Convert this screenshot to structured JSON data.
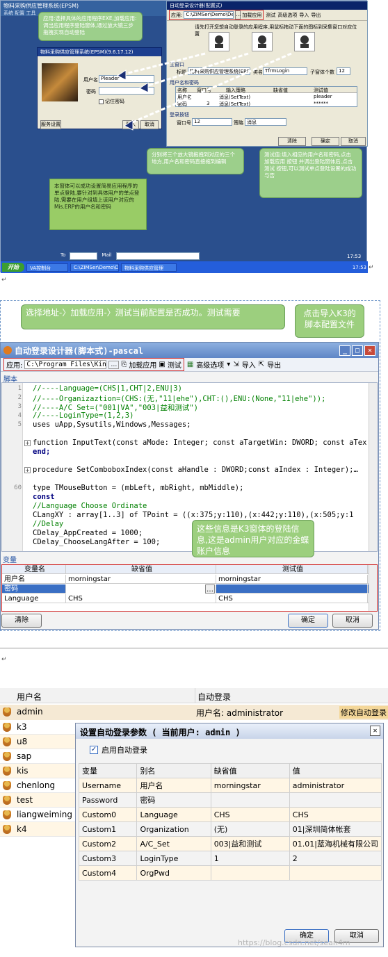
{
  "panel1": {
    "sys_title": "物料采购供应管理系统(EPSM)",
    "sys_menu": "系统  配置  工具",
    "main_title": "自动登录设计器(配置式)",
    "app_label": "应用:",
    "app_path": "C:\\ZIMSer\\Demo\\Dev\\Demo1\\",
    "load_btn": "加载应用",
    "test_btn": "测试",
    "adv_btn": "高级选项",
    "import_btn": "导入",
    "export_btn": "导出",
    "hint": "请先打开您想自动登录的应用程序,用鼠标拖动下面的图标到采集窗口对应位置",
    "main_section": "主窗口",
    "title_label": "标题",
    "title_value": "物料采购供应管理系统(EPSM)(9",
    "class_label": "类名",
    "class_value": "TfrmLogin",
    "sub_count_label": "子窗体个数",
    "sub_count": "12",
    "user_section": "用户名和密码",
    "col_headers": [
      "名称",
      "窗口号",
      "输入策略",
      "缺省值",
      "测试值"
    ],
    "rows": [
      [
        "用户名",
        "",
        "消息(SetText)",
        "",
        "pleader"
      ],
      [
        "密码",
        "3",
        "消息(SetText)",
        "",
        "******"
      ]
    ],
    "login_section": "登录按钮",
    "win_label": "窗口号",
    "win_value": "12",
    "strategy_label": "策略",
    "strategy_value": "消息",
    "clear_btn": "清除",
    "ok_btn": "确定",
    "cancel_btn": "取消",
    "bubble_top": "应用:选择具体的应用程序EXE,加载应用:调出应用程序登陆窗体,通过放大镜三步拖拽实现自动登陆",
    "login_title": "物料采购供应管理系统(EPSM)(9.6.17.12)",
    "login_user_label": "用户名",
    "login_user_value": "Pleader",
    "login_pwd_label": "密码",
    "remember": "记住密码",
    "server_btn": "服务设置",
    "login_ok": "登入",
    "login_cancel": "取消",
    "bubble_mid": "分别将三个放大镜拖拽到对应的三个地方,用户名和密码直接拖到编辑",
    "bubble_right": "测试值:填入相应的用户名和密码,点击 加载应用 按钮 并调出登陆窗体后,点击 测试 按钮,可以测试单点登陆设置的成功与否",
    "bubble_bottom": "本窗体可以成功设置简易应用程序的单点登陆,要针对到具体用户的单点登陆,需要在用户组填上该用户对应的Mis.ERP的用户名和密码",
    "status_to": "To",
    "status_mail": "Mail",
    "status_time": "17:53",
    "task_start": "开始",
    "task_items": [
      "VA控制台",
      "C:\\ZIMSer\\Demo\\Dev...",
      "物料采购供应管理"
    ],
    "task_time": "17:53"
  },
  "panel2": {
    "bubble_left": "选择地址-〉加载应用-〉测试当前配置是否成功。测试需要",
    "bubble_right": "点击导入K3的脚本配置文件",
    "title": "自动登录设计器(脚本式)-pascal",
    "app_label": "应用:",
    "app_path": "C:\\Program Files\\Kingdee",
    "load_btn": "加载应用",
    "test_btn": "测试",
    "adv_btn": "高级选项",
    "import_btn": "导入",
    "export_btn": "导出",
    "script_label": "脚本",
    "line_numbers": [
      "1",
      "2",
      "3",
      "4",
      "5",
      "",
      "",
      "",
      "",
      "",
      "60"
    ],
    "code": [
      "//----Language=(CHS|1,CHT|2,ENU|3)",
      "//----Organizaztion=(CHS:(无,\"11|ehe\"),CHT:(),ENU:(None,\"11|ehe\"));",
      "//----A/C Set=(\"001|VA\",\"003|益和测试\")",
      "//----LoginType=(1,2,3)",
      "uses uApp,Sysutils,Windows,Messages;",
      "function InputText(const aMode: Integer; const aTargetWin: DWORD; const aTex",
      "end;",
      "procedure SetComboboxIndex(const aHandle : DWORD;const aIndex : Integer);…",
      "type TMouseButton = (mbLeft, mbRight, mbMiddle);",
      "const",
      "  //Language Choose Ordinate",
      "  CLangXY : array[1..3] of TPoint = ((x:375;y:110),(x:442;y:110),(x:505;y:1",
      "  //Delay",
      "  CDelay_AppCreated = 1000;",
      "  CDelay_ChooseLangAfter = 100;"
    ],
    "bubble_info": "这些信息是K3窗体的登陆信息,这是admin用户对应的金蝶账户信息",
    "var_label": "变量",
    "grid_headers": [
      "变量名",
      "缺省值",
      "测试值"
    ],
    "grid_rows": [
      [
        "用户名",
        "morningstar",
        "morningstar"
      ],
      [
        "密码",
        "",
        ""
      ],
      [
        "Language",
        "CHS",
        "CHS"
      ]
    ],
    "clear_btn": "清除",
    "ok_btn": "确定",
    "cancel_btn": "取消"
  },
  "panel3": {
    "col_user": "用户名",
    "col_auto": "自动登录",
    "users": [
      "admin",
      "k3",
      "u8",
      "sap",
      "kis",
      "chenlong",
      "test",
      "liangweiming",
      "k4"
    ],
    "admin_auto": "用户名: administrator",
    "modify_btn": "修改自动登录",
    "dialog_title": "设置自动登录参数 ( 当前用户: admin )",
    "enable_label": "启用自动登录",
    "table_headers": [
      "变量",
      "别名",
      "缺省值",
      "值"
    ],
    "table_rows": [
      [
        "Username",
        "用户名",
        "morningstar",
        "administrator"
      ],
      [
        "Password",
        "密码",
        "",
        ""
      ],
      [
        "Custom0",
        "Language",
        "CHS",
        "CHS"
      ],
      [
        "Custom1",
        "Organization",
        "(无)",
        "01|深圳简体帐套"
      ],
      [
        "Custom2",
        "A/C_Set",
        "003|益和测试",
        "01.01|蓝海机械有限公司"
      ],
      [
        "Custom3",
        "LoginType",
        "1",
        "2"
      ],
      [
        "Custom4",
        "OrgPwd",
        "",
        ""
      ]
    ],
    "ok_btn": "确定",
    "cancel_btn": "取消",
    "watermark": "https://blog.csdn.net/sean4m"
  }
}
